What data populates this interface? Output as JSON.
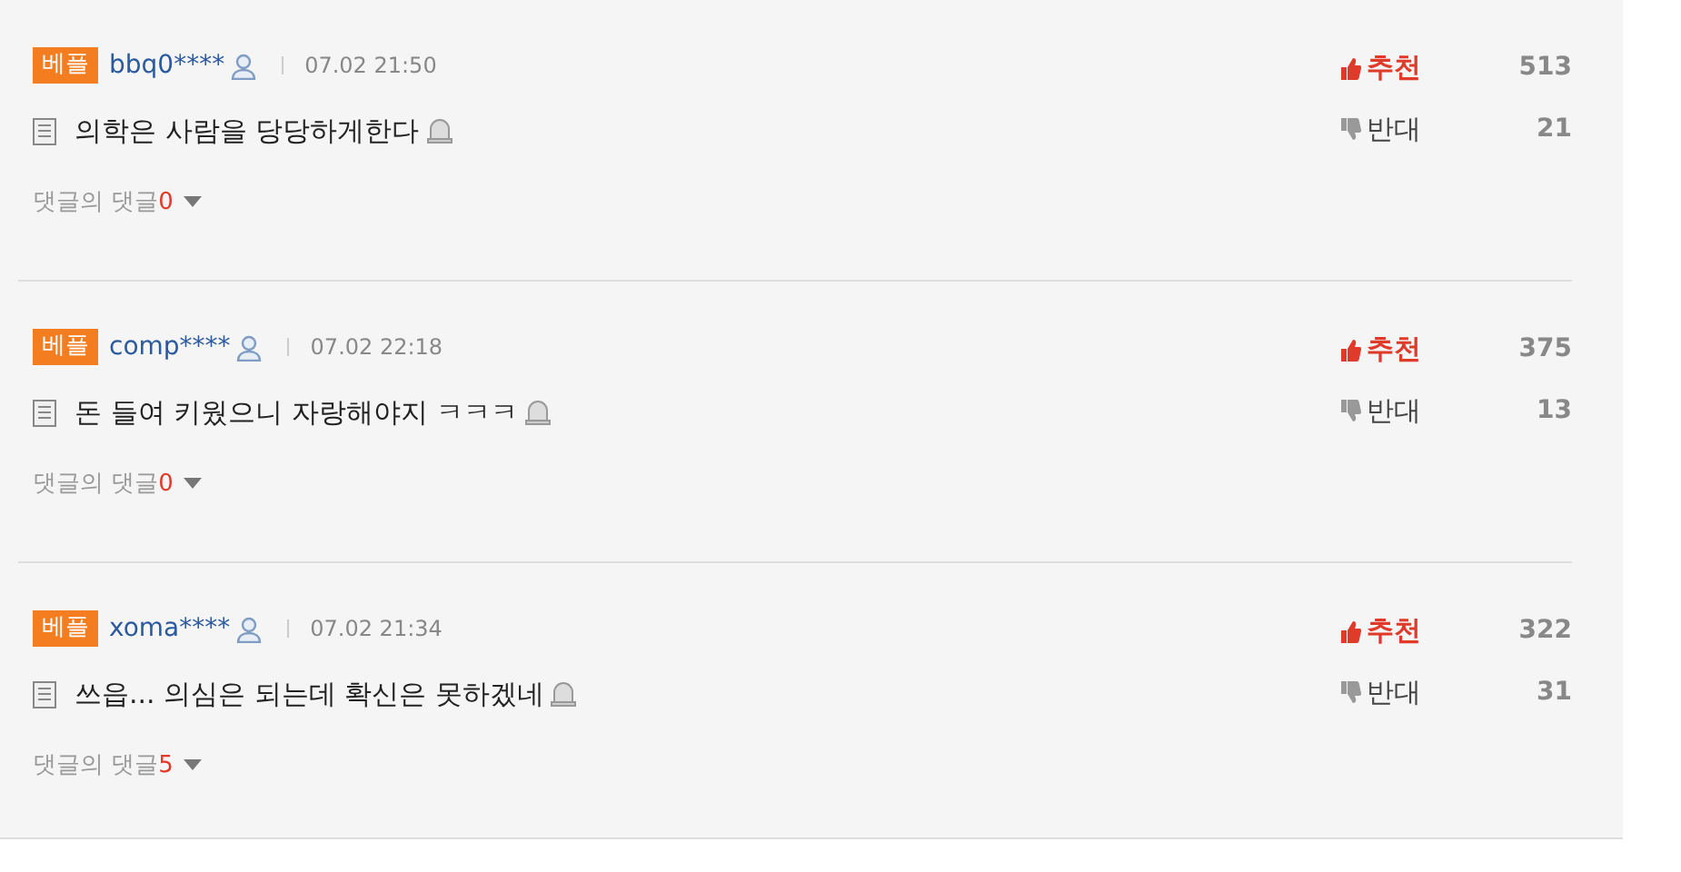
{
  "comments": [
    {
      "badge": "베플",
      "user": "bbq0****",
      "time": "07.02 21:50",
      "text": "의학은 사람을 당당하게한다",
      "recommend_label": "추천",
      "recommend": "513",
      "oppose_label": "반대",
      "oppose": "21",
      "replies_label": "댓글의 댓글",
      "replies": "0"
    },
    {
      "badge": "베플",
      "user": "comp****",
      "time": "07.02 22:18",
      "text": "돈 들여 키웠으니 자랑해야지 ㅋㅋㅋ",
      "recommend_label": "추천",
      "recommend": "375",
      "oppose_label": "반대",
      "oppose": "13",
      "replies_label": "댓글의 댓글",
      "replies": "0"
    },
    {
      "badge": "베플",
      "user": "xoma****",
      "time": "07.02 21:34",
      "text": "쓰읍... 의심은 되는데 확신은 못하겠네",
      "recommend_label": "추천",
      "recommend": "322",
      "oppose_label": "반대",
      "oppose": "31",
      "replies_label": "댓글의 댓글",
      "replies": "5"
    }
  ]
}
